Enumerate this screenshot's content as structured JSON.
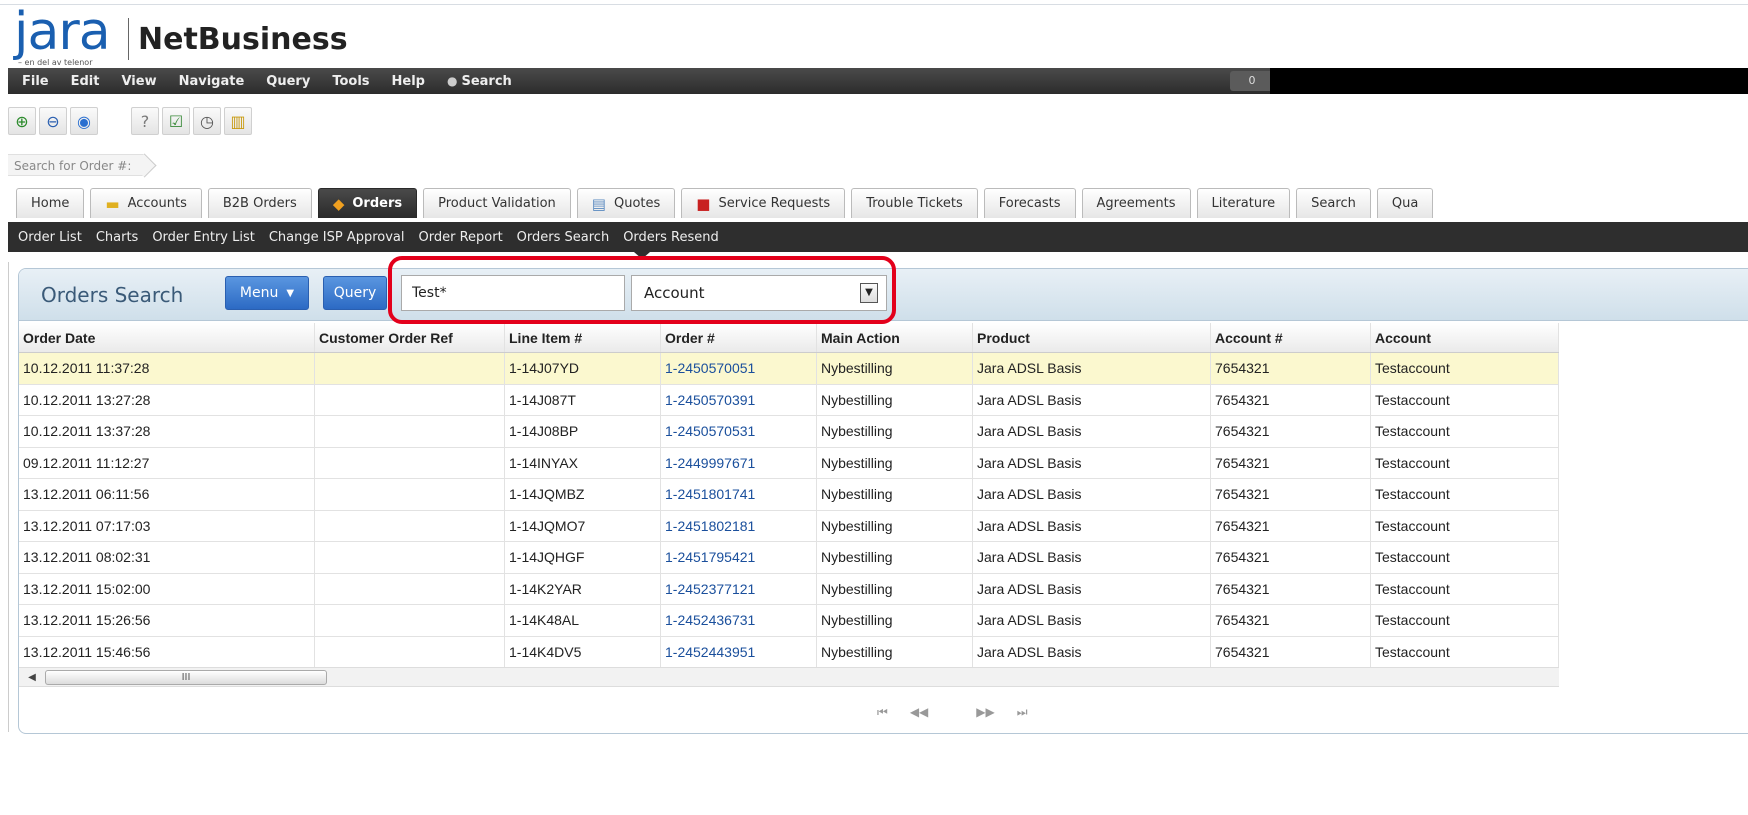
{
  "brand": {
    "logo": "jara",
    "tagline": "– en del av telenor",
    "app_name": "NetBusiness"
  },
  "menubar": {
    "items": [
      "File",
      "Edit",
      "View",
      "Navigate",
      "Query",
      "Tools",
      "Help"
    ],
    "search_label": "Search",
    "count": "0"
  },
  "breadcrumb": "Search for Order #:",
  "tabs": [
    {
      "label": "Home",
      "icon": ""
    },
    {
      "label": "Accounts",
      "icon": "folder-icon"
    },
    {
      "label": "B2B Orders",
      "icon": ""
    },
    {
      "label": "Orders",
      "icon": "tag-icon",
      "active": true
    },
    {
      "label": "Product Validation",
      "icon": ""
    },
    {
      "label": "Quotes",
      "icon": "document-icon"
    },
    {
      "label": "Service Requests",
      "icon": "toolbox-icon"
    },
    {
      "label": "Trouble Tickets",
      "icon": ""
    },
    {
      "label": "Forecasts",
      "icon": ""
    },
    {
      "label": "Agreements",
      "icon": ""
    },
    {
      "label": "Literature",
      "icon": ""
    },
    {
      "label": "Search",
      "icon": ""
    },
    {
      "label": "Qua",
      "icon": ""
    }
  ],
  "subnav": [
    "Order List",
    "Charts",
    "Order Entry List",
    "Change ISP Approval",
    "Order Report",
    "Orders Search",
    "Orders Resend"
  ],
  "panel": {
    "title": "Orders Search",
    "menu_label": "Menu",
    "query_label": "Query",
    "search_value": "Test*",
    "search_field": "Account"
  },
  "table": {
    "columns": [
      "Order Date",
      "Customer Order Ref",
      "Line Item #",
      "Order #",
      "Main Action",
      "Product",
      "Account #",
      "Account"
    ],
    "rows": [
      [
        "10.12.2011 11:37:28",
        "",
        "1-14J07YD",
        "1-2450570051",
        "Nybestilling",
        "Jara ADSL Basis",
        "7654321",
        "Testaccount"
      ],
      [
        "10.12.2011 13:27:28",
        "",
        "1-14J087T",
        "1-2450570391",
        "Nybestilling",
        "Jara ADSL Basis",
        "7654321",
        "Testaccount"
      ],
      [
        "10.12.2011 13:37:28",
        "",
        "1-14J08BP",
        "1-2450570531",
        "Nybestilling",
        "Jara ADSL Basis",
        "7654321",
        "Testaccount"
      ],
      [
        "09.12.2011 11:12:27",
        "",
        "1-14INYAX",
        "1-2449997671",
        "Nybestilling",
        "Jara ADSL Basis",
        "7654321",
        "Testaccount"
      ],
      [
        "13.12.2011 06:11:56",
        "",
        "1-14JQMBZ",
        "1-2451801741",
        "Nybestilling",
        "Jara ADSL Basis",
        "7654321",
        "Testaccount"
      ],
      [
        "13.12.2011 07:17:03",
        "",
        "1-14JQMO7",
        "1-2451802181",
        "Nybestilling",
        "Jara ADSL Basis",
        "7654321",
        "Testaccount"
      ],
      [
        "13.12.2011 08:02:31",
        "",
        "1-14JQHGF",
        "1-2451795421",
        "Nybestilling",
        "Jara ADSL Basis",
        "7654321",
        "Testaccount"
      ],
      [
        "13.12.2011 15:02:00",
        "",
        "1-14K2YAR",
        "1-2452377121",
        "Nybestilling",
        "Jara ADSL Basis",
        "7654321",
        "Testaccount"
      ],
      [
        "13.12.2011 15:26:56",
        "",
        "1-14K48AL",
        "1-2452436731",
        "Nybestilling",
        "Jara ADSL Basis",
        "7654321",
        "Testaccount"
      ],
      [
        "13.12.2011 15:46:56",
        "",
        "1-14K4DV5",
        "1-2452443951",
        "Nybestilling",
        "Jara ADSL Basis",
        "7654321",
        "Testaccount"
      ]
    ]
  },
  "scrollbar": {
    "thumb_label": "III"
  },
  "colors": {
    "brand_blue": "#1a5fb0",
    "highlight_red": "#e3001b",
    "selected_row": "#fbf8cf"
  }
}
